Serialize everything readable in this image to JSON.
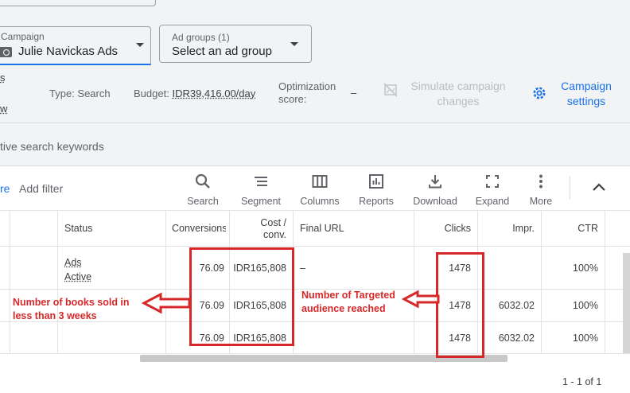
{
  "campaign_selector": {
    "label": "Campaign",
    "value": "Julie Navickas Ads"
  },
  "adgroup_selector": {
    "label": "Ad groups (1)",
    "value": "Select an ad group"
  },
  "left_fragments": {
    "a": "s",
    "b": "w",
    "keywords": "tive search keywords",
    "more": "re"
  },
  "info_bar": {
    "type": "Type: Search",
    "budget_label": "Budget:",
    "budget_value": "IDR39,416.00/day",
    "opt_line1": "Optimization",
    "opt_line2": "score:",
    "opt_value": "–",
    "simulate_line1": "Simulate campaign",
    "simulate_line2": "changes",
    "settings_line1": "Campaign",
    "settings_line2": "settings"
  },
  "toolbar": {
    "add_filter": "Add filter",
    "search": "Search",
    "segment": "Segment",
    "columns": "Columns",
    "reports": "Reports",
    "download": "Download",
    "expand": "Expand",
    "more": "More"
  },
  "table": {
    "headers": {
      "status": "Status",
      "conversions": "Conversions",
      "cost_l1": "Cost /",
      "cost_l2": "conv.",
      "final_url": "Final URL",
      "clicks": "Clicks",
      "impr": "Impr.",
      "ctr": "CTR"
    },
    "rows": [
      {
        "status_1": "Ads",
        "status_2": "Active",
        "conversions": "76.09",
        "cost": "IDR165,808",
        "final_url": "–",
        "clicks": "1478",
        "impr": "",
        "ctr": "100%"
      },
      {
        "conversions": "76.09",
        "cost": "IDR165,808",
        "clicks": "1478",
        "impr": "6032.02",
        "ctr": "100%"
      },
      {
        "conversions": "76.09",
        "cost": "IDR165,808",
        "clicks": "1478",
        "impr": "6032.02",
        "ctr": "100%"
      }
    ]
  },
  "annotations": {
    "books_1": "Number of books sold in",
    "books_2": "less than 3 weeks",
    "audience_1": "Number of Targeted",
    "audience_2": "audience reached"
  },
  "pagination": "1 - 1 of 1",
  "colors": {
    "accent": "#1a73e8",
    "annotation": "#d62828",
    "card": "#ffffff",
    "page_bg": "#f1f3f4"
  }
}
